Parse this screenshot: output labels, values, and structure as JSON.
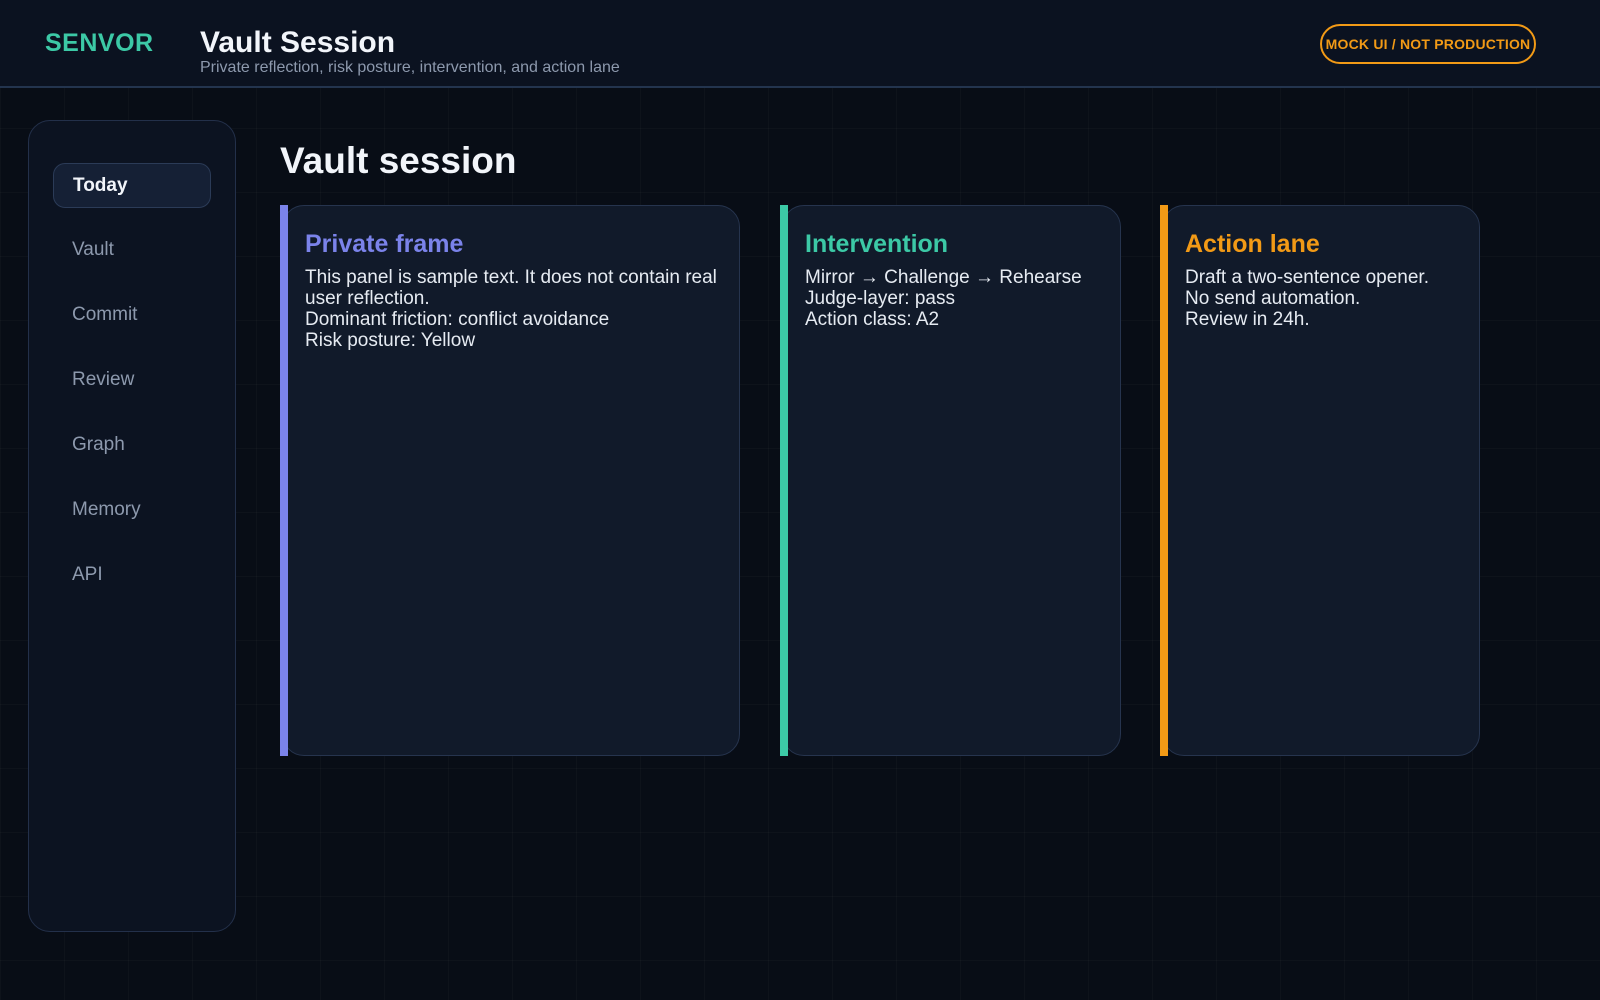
{
  "header": {
    "brand": "SENVOR",
    "title": "Vault Session",
    "subtitle": "Private reflection, risk posture, intervention, and action lane",
    "badge": "MOCK UI / NOT PRODUCTION"
  },
  "sidebar": {
    "items": [
      {
        "label": "Today",
        "active": true
      },
      {
        "label": "Vault"
      },
      {
        "label": "Commit"
      },
      {
        "label": "Review"
      },
      {
        "label": "Graph"
      },
      {
        "label": "Memory"
      },
      {
        "label": "API"
      }
    ]
  },
  "main": {
    "page_title": "Vault session",
    "panels": [
      {
        "title": "Private frame",
        "color": "#7b83ea",
        "lines": [
          "This panel is sample text. It does not contain real user reflection.",
          "Dominant friction: conflict avoidance",
          "Risk posture: Yellow"
        ]
      },
      {
        "title": "Intervention",
        "color": "#3cc9a6",
        "lines": [
          "Mirror → Challenge → Rehearse",
          "Judge-layer: pass",
          "Action class: A2"
        ]
      },
      {
        "title": "Action lane",
        "color": "#f29a16",
        "lines": [
          "Draft a two-sentence opener.",
          "No send automation.",
          "Review in 24h."
        ]
      }
    ]
  }
}
